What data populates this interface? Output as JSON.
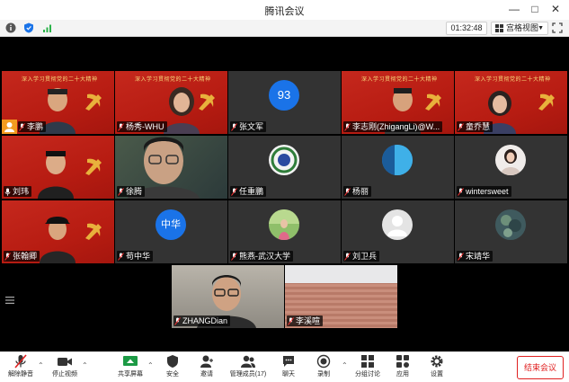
{
  "window": {
    "title": "腾讯会议"
  },
  "infobar": {
    "timer": "01:32:48",
    "view_label": "宫格视图"
  },
  "banner_text": "深入学习贯彻党的二十大精神",
  "participants": [
    {
      "name": "李鹏"
    },
    {
      "name": "杨秀-WHU"
    },
    {
      "name": "张文军",
      "avatar_text": "93"
    },
    {
      "name": "李志刚(ZhigangLi)@W..."
    },
    {
      "name": "童乔慧"
    },
    {
      "name": "刘玮"
    },
    {
      "name": "徐腾"
    },
    {
      "name": "任重鵬"
    },
    {
      "name": "杨丽"
    },
    {
      "name": "wintersweet"
    },
    {
      "name": "张翰卿"
    },
    {
      "name": "苟中华",
      "avatar_text": "中华"
    },
    {
      "name": "熊燕-武汉大学"
    },
    {
      "name": "刘卫兵"
    },
    {
      "name": "宋靖华"
    },
    {
      "name": "ZHANGDian"
    },
    {
      "name": "李溪喧"
    }
  ],
  "toolbar": {
    "mute": "解除静音",
    "video": "停止视频",
    "share": "共享屏幕",
    "security": "安全",
    "invite": "邀请",
    "members": "管理成员(17)",
    "chat": "聊天",
    "record": "录制",
    "breakout": "分组讨论",
    "apps": "应用",
    "settings": "设置",
    "end": "结束会议"
  },
  "colors": {
    "accent": "#1a73e8",
    "end_red": "#e02020",
    "banner_red": "#c5281d"
  }
}
